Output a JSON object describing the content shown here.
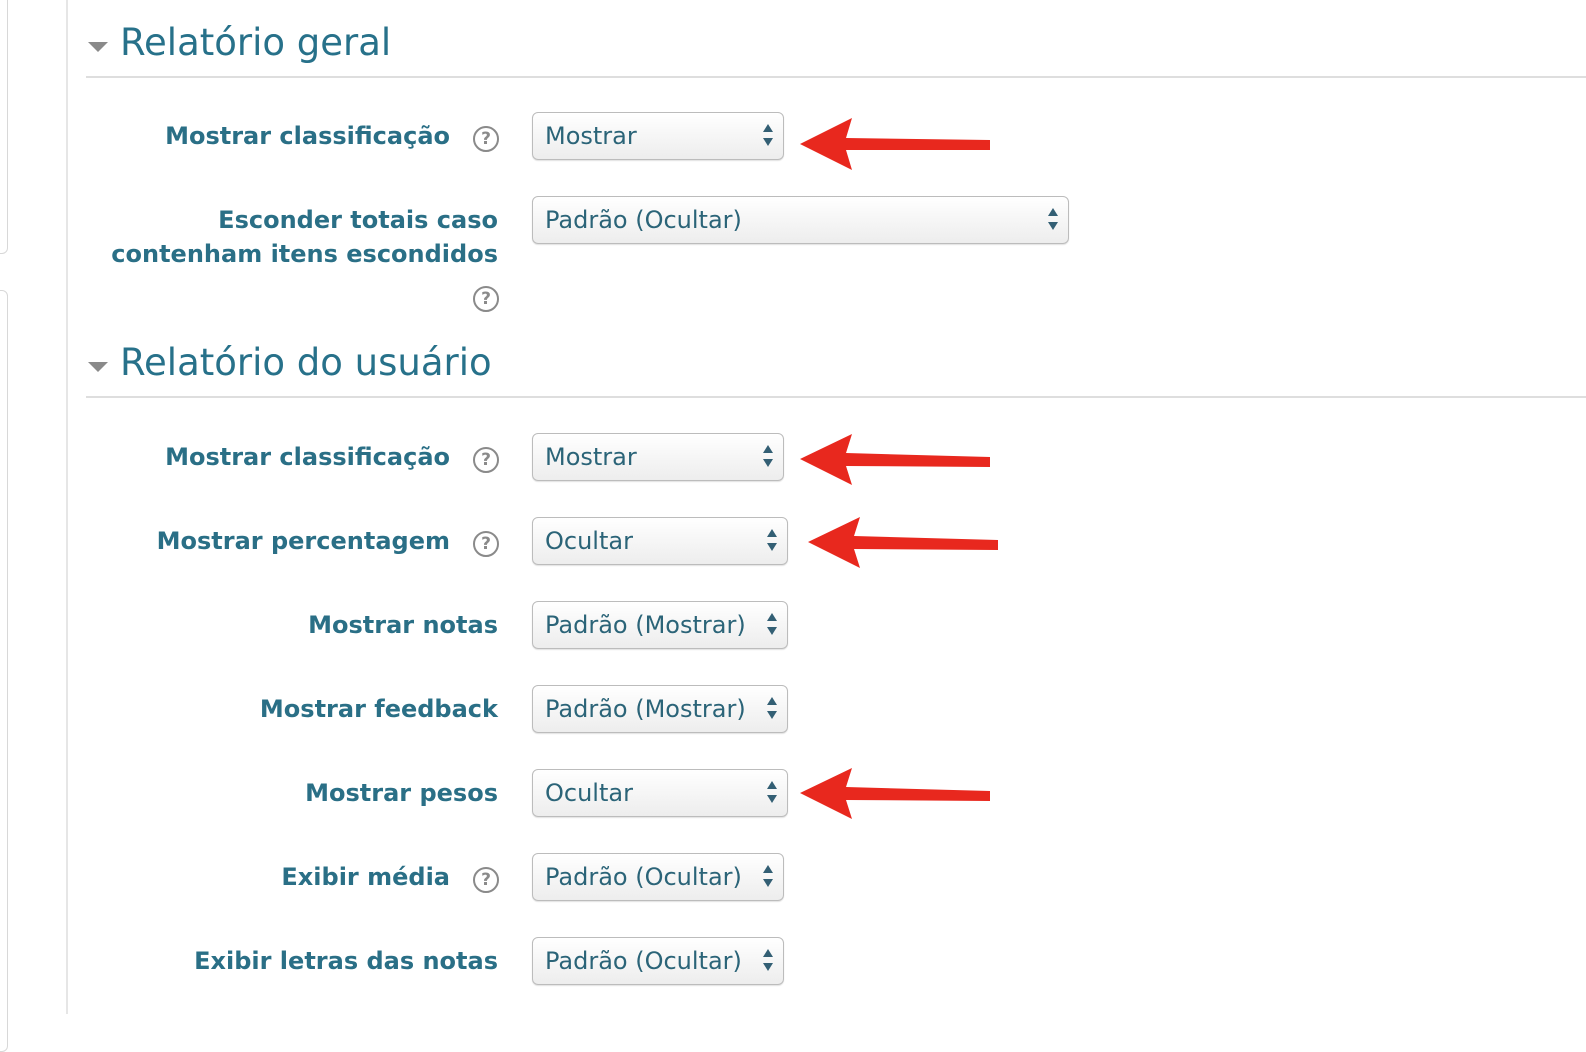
{
  "sections": [
    {
      "title": "Relatório geral",
      "rows": [
        {
          "label": "Mostrar classificação",
          "value": "Mostrar",
          "help": true,
          "annotated": true
        },
        {
          "label_lines": [
            "Esconder totais caso",
            "contenham itens escondidos"
          ],
          "value": "Padrão (Ocultar)",
          "help": true,
          "annotated": false
        }
      ]
    },
    {
      "title": "Relatório do usuário",
      "rows": [
        {
          "label": "Mostrar classificação",
          "value": "Mostrar",
          "help": true,
          "annotated": true
        },
        {
          "label": "Mostrar percentagem",
          "value": "Ocultar",
          "help": true,
          "annotated": true
        },
        {
          "label": "Mostrar notas",
          "value": "Padrão (Mostrar)",
          "help": false,
          "annotated": false
        },
        {
          "label": "Mostrar feedback",
          "value": "Padrão (Mostrar)",
          "help": false,
          "annotated": false
        },
        {
          "label": "Mostrar pesos",
          "value": "Ocultar",
          "help": false,
          "annotated": true
        },
        {
          "label": "Exibir média",
          "value": "Padrão (Ocultar)",
          "help": true,
          "annotated": false
        },
        {
          "label": "Exibir letras das notas",
          "value": "Padrão (Ocultar)",
          "help": false,
          "annotated": false
        }
      ]
    }
  ],
  "help_glyph": "?",
  "icons": {
    "collapse": "triangle-down-icon",
    "help": "question-circle-icon",
    "select": "up-down-arrows-icon",
    "annotation": "red-arrow-icon"
  },
  "colors": {
    "heading": "#27718a",
    "label": "#2a6f86",
    "annotation_arrow": "#e8281e",
    "select_text": "#2b6478"
  }
}
